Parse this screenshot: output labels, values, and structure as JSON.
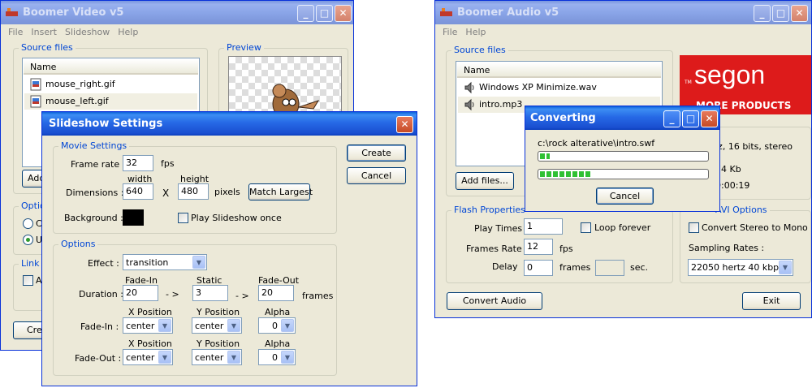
{
  "video_window": {
    "title": "Boomer Video v5",
    "menu": [
      "File",
      "Insert",
      "Slideshow",
      "Help"
    ],
    "source_files_legend": "Source files",
    "name_column": "Name",
    "files": [
      "mouse_right.gif",
      "mouse_left.gif"
    ],
    "preview_legend": "Preview",
    "add_button_partial": "Add",
    "options_partial": "Optio",
    "radio1_partial": "Cl",
    "radio2_partial": "U",
    "link_partial": "Link",
    "link_check_partial": "A",
    "create_partial": "Crea"
  },
  "slideshow_dialog": {
    "title": "Slideshow Settings",
    "movie_settings_legend": "Movie Settings",
    "frame_rate_label": "Frame rate :",
    "frame_rate_value": "32",
    "fps_label": "fps",
    "width_label": "width",
    "height_label": "height",
    "dimensions_label": "Dimensions :",
    "width_value": "640",
    "x_label": "X",
    "height_value": "480",
    "pixels_label": "pixels",
    "match_largest_label": "Match Largest",
    "background_label": "Background :",
    "background_color": "#000000",
    "play_once_label": "Play Slideshow once",
    "options_legend": "Options",
    "effect_label": "Effect :",
    "effect_value": "transition",
    "fade_in_header": "Fade-In",
    "static_header": "Static",
    "fade_out_header": "Fade-Out",
    "duration_label": "Duration :",
    "fade_in_duration": "20",
    "arrow1": "- >",
    "static_duration": "3",
    "arrow2": "- >",
    "fade_out_duration": "20",
    "frames_label": "frames",
    "x_position_label": "X Position",
    "y_position_label": "Y Position",
    "alpha_label": "Alpha",
    "fade_in_row_label": "Fade-In :",
    "fade_in_x": "center",
    "fade_in_y": "center",
    "fade_in_alpha": "0",
    "fade_out_row_label": "Fade-Out :",
    "fade_out_x": "center",
    "fade_out_y": "center",
    "fade_out_alpha": "0",
    "create_label": "Create",
    "cancel_label": "Cancel"
  },
  "audio_window": {
    "title": "Boomer Audio v5",
    "menu": [
      "File",
      "Help"
    ],
    "source_files_legend": "Source files",
    "name_column": "Name",
    "files": [
      "Windows XP Minimize.wav",
      "intro.mp3"
    ],
    "brand_text": "segon",
    "brand_tm": "TM",
    "brand_sub": "MORE PRODUCTS",
    "info_partial": "fo",
    "info_line1_partial": "lz, 16 bits, stereo",
    "info_line2_partial": "74 Kb",
    "info_line3_partial": "0:00:19",
    "add_files_label": "Add files...",
    "flash_properties_legend": "Flash Properties",
    "play_times_label": "Play Times",
    "play_times_value": "1",
    "loop_forever_label": "Loop forever",
    "frames_rate_label": "Frames Rate",
    "frames_rate_value": "12",
    "fps_label": "fps",
    "delay_label": "Delay",
    "delay_value": "0",
    "delay_frames_label": "frames",
    "delay_sec_label": "sec.",
    "avi_options_partial": "AVI Options",
    "convert_stereo_label": "Convert Stereo to Mono",
    "sampling_rates_label": "Sampling Rates :",
    "sampling_rate_value": "22050 hertz 40 kbps",
    "convert_audio_label": "Convert Audio",
    "exit_label": "Exit"
  },
  "converting_dialog": {
    "title": "Converting",
    "path": "c:\\rock alterative\\intro.swf",
    "progress_file": 0.06,
    "progress_total": 0.31,
    "cancel_label": "Cancel"
  },
  "colors": {
    "title_active": "#2669e6",
    "title_inactive": "#8aa5e8",
    "legend_blue": "#0046d5",
    "brand_red": "#dd1b1b",
    "progress_green": "#2fc033"
  }
}
